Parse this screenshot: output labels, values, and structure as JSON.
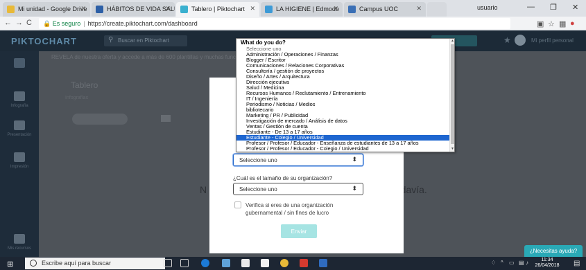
{
  "browser": {
    "tabs": [
      {
        "label": "Mi unidad - Google Drive",
        "icon": "google-drive-icon",
        "active": false
      },
      {
        "label": "HÁBITOS DE VIDA SALUD",
        "icon": "document-icon",
        "active": false
      },
      {
        "label": "Tablero | Piktochart",
        "icon": "piktochart-icon",
        "active": true
      },
      {
        "label": "LA HIGIENE | Edmodo",
        "icon": "edmodo-icon",
        "active": false
      },
      {
        "label": "Campus UOC",
        "icon": "uoc-icon",
        "active": false
      }
    ],
    "profile": "usuario",
    "secure_label": "Es seguro",
    "url": "https://create.piktochart.com/dashboard"
  },
  "app": {
    "logo": "PIKTOCHART",
    "search_placeholder": "Buscar en Piktochart",
    "user_name": "Mi perfil personal",
    "notice": "REVELA de nuestra oferta y accede a más de 600 plantillas y muchas funcionalidades más",
    "board_title": "Tablero",
    "board_subtitle": "Infografías",
    "new_button": "Crear nuevo",
    "bg_text_left": "N",
    "bg_text_right": "todavía.",
    "sidebar": [
      {
        "label": "Infografía",
        "icon": "infographic-icon"
      },
      {
        "label": "Presentación",
        "icon": "presentation-icon"
      },
      {
        "label": "Impresión",
        "icon": "print-icon"
      },
      {
        "label": "Mis recursos",
        "icon": "resources-icon"
      }
    ]
  },
  "modal": {
    "role_select_value": "Seleccione uno",
    "size_question": "¿Cuál es el tamaño de su organización?",
    "size_select_value": "Seleccione uno",
    "checkbox_label": "Verifica si eres de una organización gubernamental / sin fines de lucro",
    "submit_label": "Enviar"
  },
  "dropdown": {
    "heading": "What do you do?",
    "options": [
      "Seleccione uno",
      "Administración / Operaciones / Finanzas",
      "Blogger / Escritor",
      "Comunicaciones / Relaciones Corporativas",
      "Consultoría / gestión de proyectos",
      "Diseño / Artes / Arquitectura",
      "Dirección ejecutiva",
      "Salud / Medicina",
      "Recursos Humanos / Reclutamiento / Entrenamiento",
      "IT / Ingeniería",
      "Periodismo / Noticias / Medios",
      "bibliotecario",
      "Marketing / PR / Publicidad",
      "Investigación de mercado / Análisis de datos",
      "Ventas / Gestión de cuenta",
      "Estudiante - De 13 a 17 años",
      "Estudiante - Colegio / Universidad",
      "Profesor / Profesor / Educador - Enseñanza de estudiantes de 13 a 17 años",
      "Profesor / Profesor / Educador - Colegio / Universidad"
    ],
    "selected_index": 16
  },
  "help_button": "¿Necesitas ayuda?",
  "taskbar": {
    "search_placeholder": "Escribe aquí para buscar",
    "time": "11:34",
    "date": "26/04/2018"
  }
}
